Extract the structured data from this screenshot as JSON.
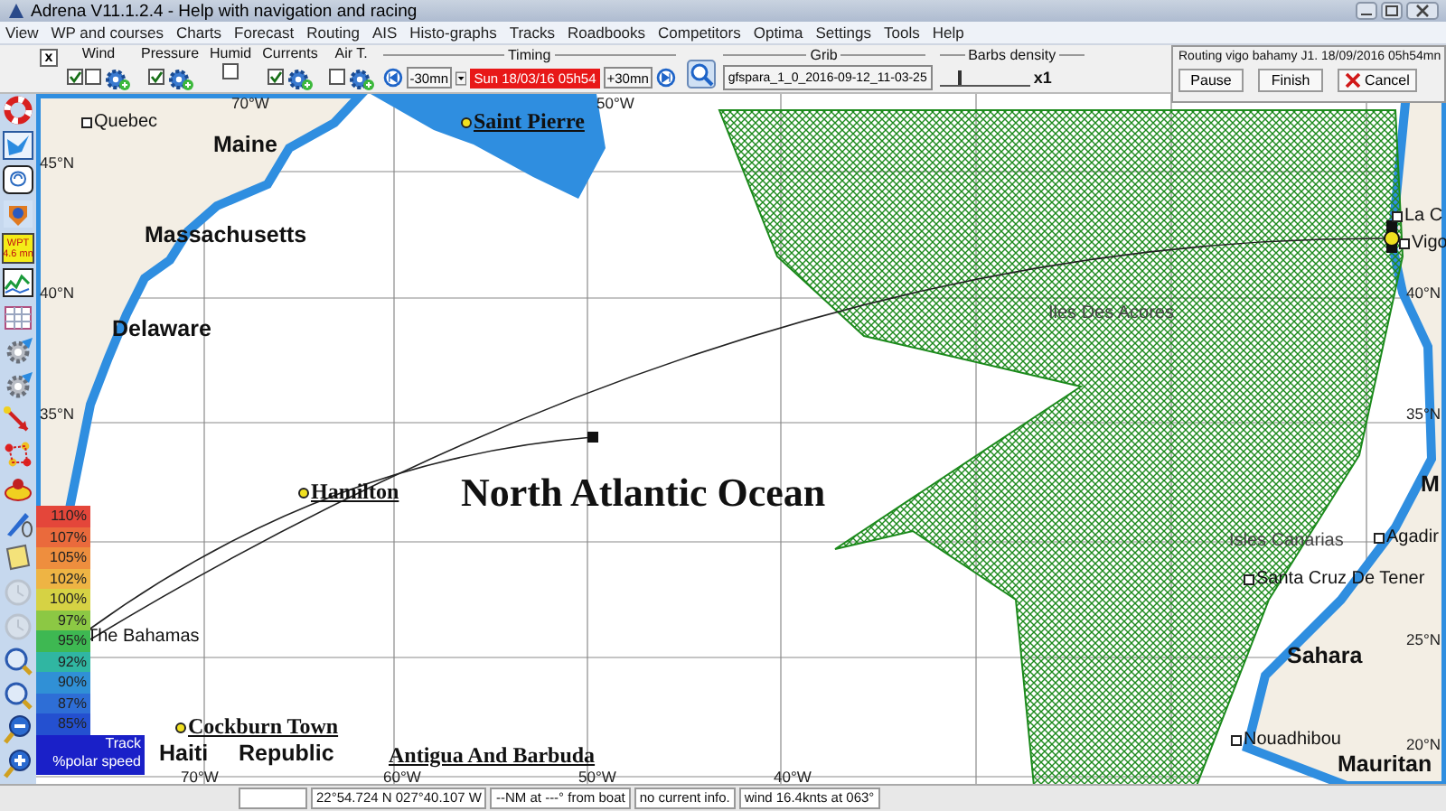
{
  "window": {
    "title": "Adrena V11.1.2.4 - Help with navigation and racing"
  },
  "menu": [
    "View",
    "WP and courses",
    "Charts",
    "Forecast",
    "Routing",
    "AIS",
    "Histo-graphs",
    "Tracks",
    "Roadbooks",
    "Competitors",
    "Optima",
    "Settings",
    "Tools",
    "Help"
  ],
  "toolbar": {
    "close_box": "x",
    "layers": [
      {
        "label": "Wind",
        "checkboxes": [
          {
            "checked": true
          },
          {
            "checked": false
          }
        ],
        "has_gear": true
      },
      {
        "label": "Pressure",
        "checkboxes": [
          {
            "checked": true
          }
        ],
        "has_gear": true
      },
      {
        "label": "Humid",
        "checkboxes": [
          {
            "checked": false
          }
        ],
        "has_gear": false
      },
      {
        "label": "Currents",
        "checkboxes": [
          {
            "checked": true
          }
        ],
        "has_gear": true
      },
      {
        "label": "Air T.",
        "checkboxes": [
          {
            "checked": false
          }
        ],
        "has_gear": true
      }
    ],
    "timing": {
      "label": "Timing",
      "back": "-30mn",
      "date": "Sun 18/03/16 05h54",
      "forward": "+30mn"
    },
    "grib": {
      "label": "Grib",
      "file": "gfspara_1_0_2016-09-12_11-03-25"
    },
    "barbs": {
      "label": "Barbs density",
      "value": "x1",
      "level": 0.2
    }
  },
  "routing": {
    "title": "Routing vigo bahamy J1. 18/09/2016 05h54mn",
    "buttons": [
      "Pause",
      "Finish",
      "Cancel"
    ]
  },
  "sidebar": {
    "tools": [
      {
        "kind": "lifebuoy",
        "disabled": false
      },
      {
        "kind": "bird",
        "disabled": false
      },
      {
        "kind": "loop",
        "disabled": false
      },
      {
        "kind": "crest",
        "disabled": false
      },
      {
        "kind": "wpt",
        "disabled": false,
        "label": "WPT",
        "value": "4.6 mn"
      },
      {
        "kind": "graph",
        "disabled": false
      },
      {
        "kind": "grid",
        "disabled": false
      },
      {
        "kind": "gear",
        "disabled": false
      },
      {
        "kind": "gear",
        "disabled": false
      },
      {
        "kind": "arrow",
        "disabled": false
      },
      {
        "kind": "dots",
        "disabled": false
      },
      {
        "kind": "disk",
        "disabled": false
      },
      {
        "kind": "pen",
        "disabled": false
      },
      {
        "kind": "note",
        "disabled": false
      },
      {
        "kind": "clock",
        "disabled": true
      },
      {
        "kind": "clock",
        "disabled": true
      },
      {
        "kind": "magnifier",
        "disabled": false
      },
      {
        "kind": "magnifier",
        "disabled": false
      },
      {
        "kind": "zoom-out",
        "disabled": false
      },
      {
        "kind": "zoom-in",
        "disabled": false
      }
    ]
  },
  "map": {
    "places": [
      {
        "text": "Quebec",
        "kind": "city"
      },
      {
        "text": "Saint Pierre",
        "kind": "capital"
      },
      {
        "text": "Maine",
        "kind": "region"
      },
      {
        "text": "Massachusetts",
        "kind": "region"
      },
      {
        "text": "Delaware",
        "kind": "region"
      },
      {
        "text": "Hamilton",
        "kind": "capital"
      },
      {
        "text": "North Atlantic Ocean",
        "kind": "ocean"
      },
      {
        "text": "The Bahamas",
        "kind": "country"
      },
      {
        "text": "Cockburn Town",
        "kind": "capital"
      },
      {
        "text": "Haiti",
        "kind": "region"
      },
      {
        "text": "Republic",
        "kind": "region"
      },
      {
        "text": "Antigua And Barbuda",
        "kind": "serif"
      },
      {
        "text": "La C",
        "kind": "city"
      },
      {
        "text": "Vigo",
        "kind": "city"
      },
      {
        "text": "Iles Des Acores",
        "kind": "island"
      },
      {
        "text": "M",
        "kind": "region"
      },
      {
        "text": "Isles Canarias",
        "kind": "island"
      },
      {
        "text": "Agadir",
        "kind": "city"
      },
      {
        "text": "Santa Cruz De Tener",
        "kind": "city"
      },
      {
        "text": "Sahara",
        "kind": "region"
      },
      {
        "text": "Nouadhibou",
        "kind": "city"
      },
      {
        "text": "Mauritan",
        "kind": "region"
      }
    ],
    "grid_labels": [
      "70°W",
      "50°W",
      "45°N",
      "40°N",
      "35°N",
      "40°N",
      "35°N",
      "25°N",
      "20°N",
      "70°W",
      "60°W",
      "50°W",
      "40°W"
    ]
  },
  "legend": {
    "items": [
      {
        "label": "110%",
        "color": "#e4463a"
      },
      {
        "label": "107%",
        "color": "#ea6a3c"
      },
      {
        "label": "105%",
        "color": "#ee8e3e"
      },
      {
        "label": "102%",
        "color": "#eeb444"
      },
      {
        "label": "100%",
        "color": "#d6d244"
      },
      {
        "label": "97%",
        "color": "#8cc844"
      },
      {
        "label": "95%",
        "color": "#3eb852"
      },
      {
        "label": "92%",
        "color": "#30b6a2"
      },
      {
        "label": "90%",
        "color": "#3090d6"
      },
      {
        "label": "87%",
        "color": "#2e6ed6"
      },
      {
        "label": "85%",
        "color": "#2450d0"
      }
    ],
    "title": "Track",
    "subtitle": "%polar speed"
  },
  "status_bar": [
    "22°54.724 N  027°40.107 W",
    "--NM at ---° from boat",
    "no current info.",
    "wind 16.4knts at 063°"
  ]
}
